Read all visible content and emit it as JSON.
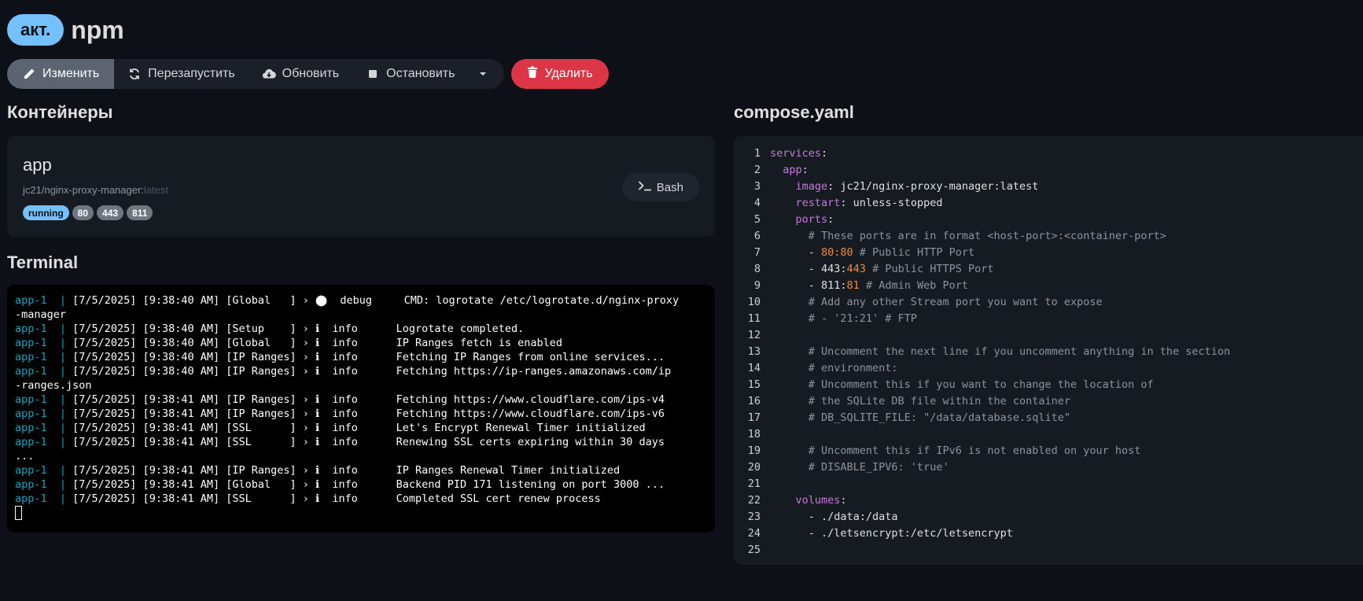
{
  "header": {
    "status": "акт.",
    "stack_name": "npm"
  },
  "toolbar": {
    "edit": "Изменить",
    "restart": "Перезапустить",
    "update": "Обновить",
    "stop": "Остановить",
    "delete": "Удалить"
  },
  "containers": {
    "title": "Контейнеры",
    "items": [
      {
        "name": "app",
        "image": "jc21/nginx-proxy-manager:",
        "tag": "latest",
        "status": "running",
        "ports": [
          "80",
          "443",
          "811"
        ],
        "bash_label": "Bash"
      }
    ]
  },
  "terminal": {
    "title": "Terminal",
    "lines": [
      {
        "prefix": "app-1  | ",
        "text": "[7/5/2025] [9:38:40 AM] [Global   ] › ⬤  debug     CMD: logrotate /etc/logrotate.d/nginx-proxy"
      },
      {
        "prefix": "",
        "text": "-manager"
      },
      {
        "prefix": "app-1  | ",
        "text": "[7/5/2025] [9:38:40 AM] [Setup    ] › ℹ  info      Logrotate completed."
      },
      {
        "prefix": "app-1  | ",
        "text": "[7/5/2025] [9:38:40 AM] [Global   ] › ℹ  info      IP Ranges fetch is enabled"
      },
      {
        "prefix": "app-1  | ",
        "text": "[7/5/2025] [9:38:40 AM] [IP Ranges] › ℹ  info      Fetching IP Ranges from online services..."
      },
      {
        "prefix": "app-1  | ",
        "text": "[7/5/2025] [9:38:40 AM] [IP Ranges] › ℹ  info      Fetching https://ip-ranges.amazonaws.com/ip"
      },
      {
        "prefix": "",
        "text": "-ranges.json"
      },
      {
        "prefix": "app-1  | ",
        "text": "[7/5/2025] [9:38:41 AM] [IP Ranges] › ℹ  info      Fetching https://www.cloudflare.com/ips-v4"
      },
      {
        "prefix": "app-1  | ",
        "text": "[7/5/2025] [9:38:41 AM] [IP Ranges] › ℹ  info      Fetching https://www.cloudflare.com/ips-v6"
      },
      {
        "prefix": "app-1  | ",
        "text": "[7/5/2025] [9:38:41 AM] [SSL      ] › ℹ  info      Let's Encrypt Renewal Timer initialized"
      },
      {
        "prefix": "app-1  | ",
        "text": "[7/5/2025] [9:38:41 AM] [SSL      ] › ℹ  info      Renewing SSL certs expiring within 30 days"
      },
      {
        "prefix": "",
        "text": "..."
      },
      {
        "prefix": "app-1  | ",
        "text": "[7/5/2025] [9:38:41 AM] [IP Ranges] › ℹ  info      IP Ranges Renewal Timer initialized"
      },
      {
        "prefix": "app-1  | ",
        "text": "[7/5/2025] [9:38:41 AM] [Global   ] › ℹ  info      Backend PID 171 listening on port 3000 ..."
      },
      {
        "prefix": "app-1  | ",
        "text": "[7/5/2025] [9:38:41 AM] [SSL      ] › ℹ  info      Completed SSL cert renew process"
      }
    ]
  },
  "compose": {
    "title": "compose.yaml",
    "lines": [
      [
        {
          "t": "services",
          "c": "k"
        },
        {
          "t": ":",
          "c": "v"
        }
      ],
      [
        {
          "t": "  "
        },
        {
          "t": "app",
          "c": "k"
        },
        {
          "t": ":",
          "c": "v"
        }
      ],
      [
        {
          "t": "    "
        },
        {
          "t": "image",
          "c": "k"
        },
        {
          "t": ": jc21/nginx-proxy-manager:latest",
          "c": "v"
        }
      ],
      [
        {
          "t": "    "
        },
        {
          "t": "restart",
          "c": "k"
        },
        {
          "t": ": unless-stopped",
          "c": "v"
        }
      ],
      [
        {
          "t": "    "
        },
        {
          "t": "ports",
          "c": "k"
        },
        {
          "t": ":",
          "c": "v"
        }
      ],
      [
        {
          "t": "      # These ports are in format <host-port>:<container-port>",
          "c": "c"
        }
      ],
      [
        {
          "t": "      - ",
          "c": "v"
        },
        {
          "t": "80:80",
          "c": "n"
        },
        {
          "t": " # Public HTTP Port",
          "c": "c"
        }
      ],
      [
        {
          "t": "      - 443:",
          "c": "v"
        },
        {
          "t": "443",
          "c": "n"
        },
        {
          "t": " # Public HTTPS Port",
          "c": "c"
        }
      ],
      [
        {
          "t": "      - 811:",
          "c": "v"
        },
        {
          "t": "81",
          "c": "n"
        },
        {
          "t": " # Admin Web Port",
          "c": "c"
        }
      ],
      [
        {
          "t": "      # Add any other Stream port you want to expose",
          "c": "c"
        }
      ],
      [
        {
          "t": "      # - '21:21' # FTP",
          "c": "c"
        }
      ],
      [
        {
          "t": ""
        }
      ],
      [
        {
          "t": "      # Uncomment the next line if you uncomment anything in the section",
          "c": "c"
        }
      ],
      [
        {
          "t": "      # environment:",
          "c": "c"
        }
      ],
      [
        {
          "t": "      # Uncomment this if you want to change the location of",
          "c": "c"
        }
      ],
      [
        {
          "t": "      # the SQLite DB file within the container",
          "c": "c"
        }
      ],
      [
        {
          "t": "      # DB_SQLITE_FILE: \"/data/database.sqlite\"",
          "c": "c"
        }
      ],
      [
        {
          "t": ""
        }
      ],
      [
        {
          "t": "      # Uncomment this if IPv6 is not enabled on your host",
          "c": "c"
        }
      ],
      [
        {
          "t": "      # DISABLE_IPV6: 'true'",
          "c": "c"
        }
      ],
      [
        {
          "t": ""
        }
      ],
      [
        {
          "t": "    "
        },
        {
          "t": "volumes",
          "c": "k"
        },
        {
          "t": ":",
          "c": "v"
        }
      ],
      [
        {
          "t": "      - ./data:/data",
          "c": "v"
        }
      ],
      [
        {
          "t": "      - ./letsencrypt:/etc/letsencrypt",
          "c": "v"
        }
      ],
      [
        {
          "t": ""
        }
      ]
    ]
  },
  "colors": {
    "background": "#0d1117",
    "status_active": "#74c0fc",
    "delete": "#dc3545",
    "yaml_key": "#c678dd",
    "yaml_number": "#f0883e",
    "terminal_prefix": "#17a2b8"
  },
  "icons": {
    "edit": "pencil-icon",
    "restart": "refresh-icon",
    "update": "cloud-download-icon",
    "stop": "stop-icon",
    "dropdown": "caret-down-icon",
    "delete": "trash-icon",
    "bash": "terminal-icon"
  }
}
